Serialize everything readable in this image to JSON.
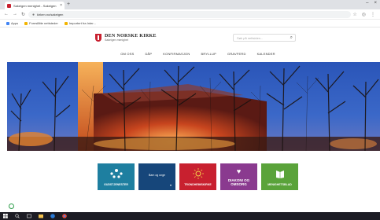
{
  "browser": {
    "tab_title": "Sakeigen menighet - Sakeigen",
    "url": "kirken.no/sakeigen",
    "bookmarks": [
      {
        "label": "Apps",
        "icon": "apps-icon"
      },
      {
        "label": "Foreslåtte nettsteder",
        "icon": "folder-icon"
      },
      {
        "label": "Importert fra Inter...",
        "icon": "folder-icon"
      }
    ]
  },
  "site": {
    "org_name": "DEN NORSKE KIRKE",
    "parish": "Sakeigen menighet",
    "search_placeholder": "Søk på nettsiden...",
    "nav": [
      "OM OSS",
      "DÅP",
      "KONFIRMASJON",
      "BRYLLUP",
      "GRAVFERD",
      "KALENDER"
    ]
  },
  "tiles": [
    {
      "label": "GUDSTJENESTER",
      "color": "#1e7fa0",
      "icon": "people-icon"
    },
    {
      "label": "Barn og unge",
      "color": "#16467a",
      "icon": "arrow-icon"
    },
    {
      "label": "TRONDHEIMSKIRKE",
      "color": "#c8202f",
      "icon": "sun-icon"
    },
    {
      "label": "DIAKONI OG OMSORG",
      "color": "#8a3a8f",
      "icon": "heart-icon"
    },
    {
      "label": "MENIGHETSBLAD",
      "color": "#5aa33a",
      "icon": "book-icon"
    }
  ]
}
